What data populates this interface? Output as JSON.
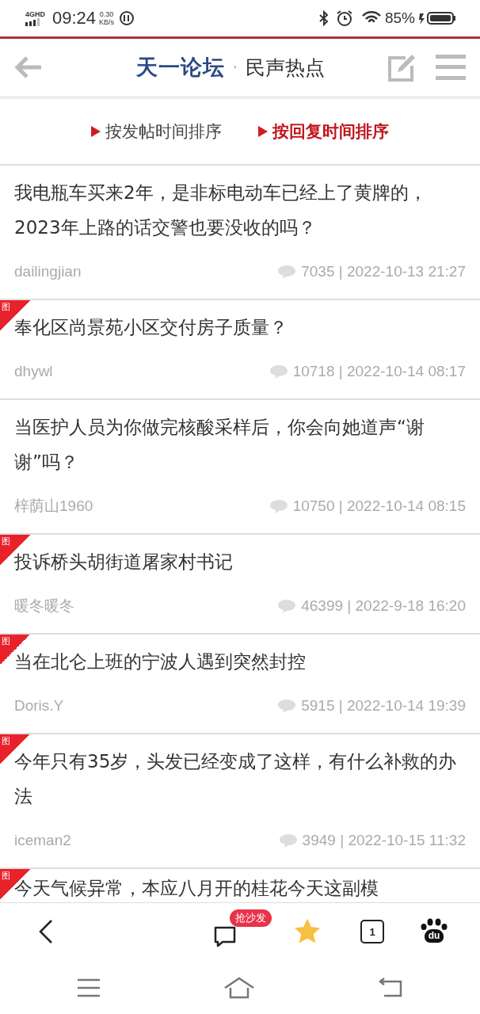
{
  "status_bar": {
    "network": "4GHD",
    "time": "09:24",
    "speed": "0.30",
    "speed_unit": "KB/s",
    "battery": "85%"
  },
  "header": {
    "logo": "天一论坛",
    "separator": "·",
    "title": "民声热点"
  },
  "sort_tabs": [
    {
      "label": "按发帖时间排序",
      "selected": false
    },
    {
      "label": "按回复时间排序",
      "selected": true
    }
  ],
  "posts": [
    {
      "title": "我电瓶车买来2年，是非标电动车已经上了黄牌的，2023年上路的话交警也要没收的吗？",
      "has_image": false,
      "author": "dailingjian",
      "replies": "7035",
      "divider": "|",
      "time": "2022-10-13 21:27"
    },
    {
      "title": "奉化区尚景苑小区交付房子质量？",
      "has_image": true,
      "badge": "图",
      "author": "dhywl",
      "replies": "10718",
      "divider": "|",
      "time": "2022-10-14 08:17"
    },
    {
      "title": "当医护人员为你做完核酸采样后，你会向她道声“谢谢”吗？",
      "has_image": false,
      "author": "梓荫山1960",
      "replies": "10750",
      "divider": "|",
      "time": "2022-10-14 08:15"
    },
    {
      "title": "投诉桥头胡街道屠家村书记",
      "has_image": true,
      "badge": "图",
      "author": "暖冬暖冬",
      "replies": "46399",
      "divider": "|",
      "time": "2022-9-18 16:20"
    },
    {
      "title": "当在北仑上班的宁波人遇到突然封控",
      "has_image": true,
      "badge": "图",
      "author": "Doris.Y",
      "replies": "5915",
      "divider": "|",
      "time": "2022-10-14 19:39"
    },
    {
      "title": "今年只有35岁，头发已经变成了这样，有什么补救的办法",
      "has_image": true,
      "badge": "图",
      "author": "iceman2",
      "replies": "3949",
      "divider": "|",
      "time": "2022-10-15 11:32"
    },
    {
      "title": "今天气候异常，本应八月开的桂花今天这副模",
      "has_image": true,
      "badge": "图"
    }
  ],
  "toolbar": {
    "comment_badge": "抢沙发",
    "starred": true,
    "tab_count": "1",
    "browser_logo": "du"
  }
}
